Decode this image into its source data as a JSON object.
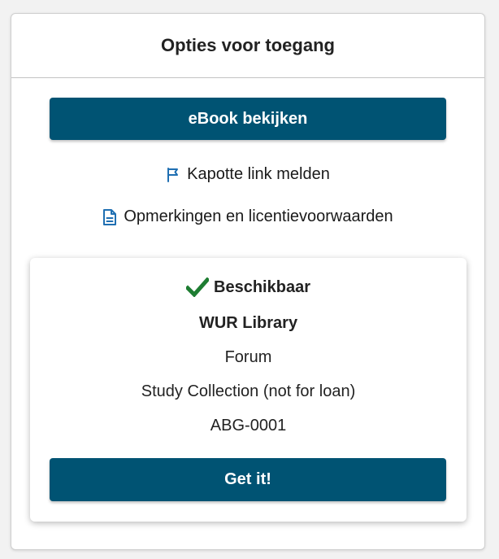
{
  "access_panel": {
    "title": "Opties voor toegang",
    "ebook_button_label": "eBook bekijken",
    "report_link_label": "Kapotte link melden",
    "notes_link_label": "Opmerkingen en licentievoorwaarden"
  },
  "holding": {
    "status": "Beschikbaar",
    "library": "WUR Library",
    "location": "Forum",
    "collection": "Study Collection (not for loan)",
    "call_number": "ABG-0001",
    "get_it_label": "Get it!"
  },
  "icons": {
    "report": "flag-icon",
    "notes": "document-icon",
    "status": "check-icon"
  },
  "colors": {
    "button": "#005373",
    "icon_link": "#1f6fb2",
    "available": "#1e7d32"
  }
}
